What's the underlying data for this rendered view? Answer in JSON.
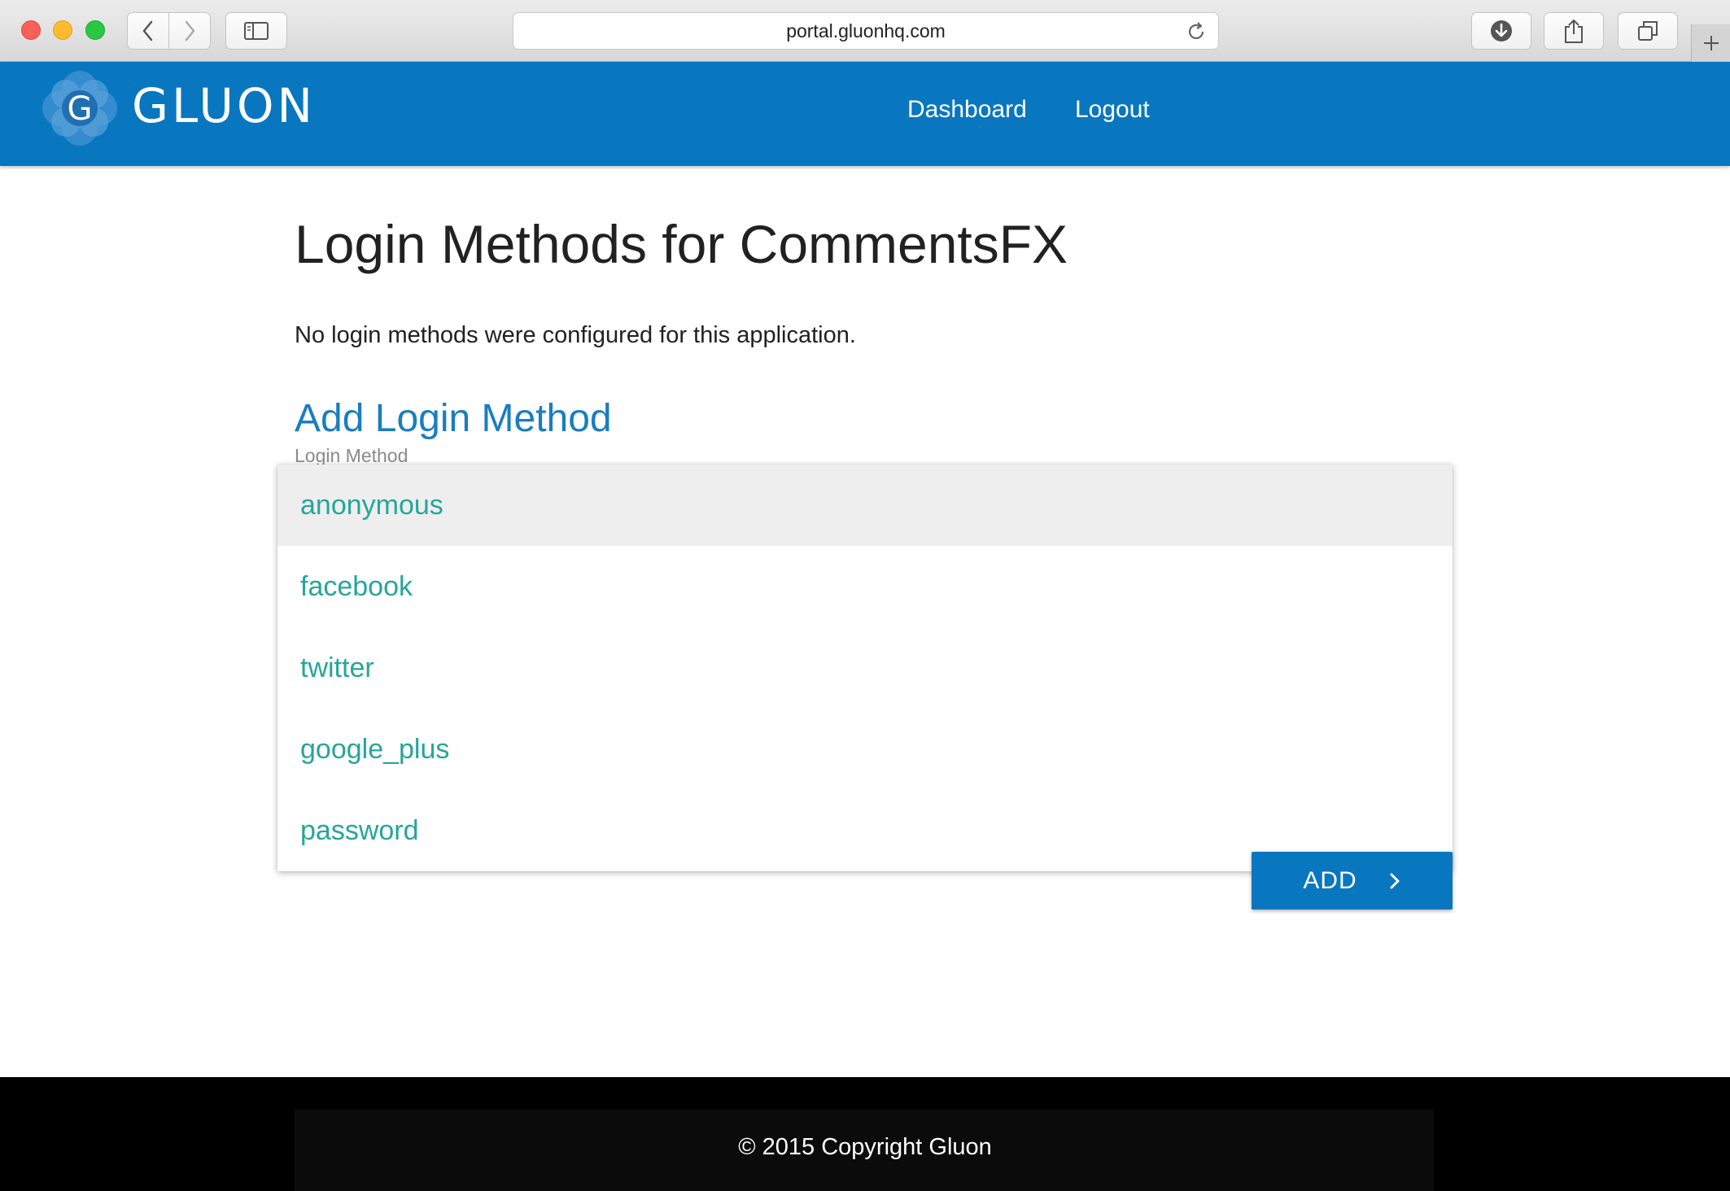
{
  "browser": {
    "url": "portal.gluonhq.com"
  },
  "header": {
    "logo_letter": "G",
    "logo_text": "GLUON",
    "nav": {
      "dashboard": "Dashboard",
      "logout": "Logout"
    },
    "brand_color": "#0877bf"
  },
  "main": {
    "title": "Login Methods for CommentsFX",
    "info": "No login methods were configured for this application.",
    "section_title": "Add Login Method",
    "field_label": "Login Method",
    "dropdown": {
      "options": [
        "anonymous",
        "facebook",
        "twitter",
        "google_plus",
        "password"
      ],
      "highlighted": "anonymous",
      "option_color": "#26a69a"
    },
    "add_button": "ADD"
  },
  "footer": {
    "text": "© 2015 Copyright Gluon"
  }
}
